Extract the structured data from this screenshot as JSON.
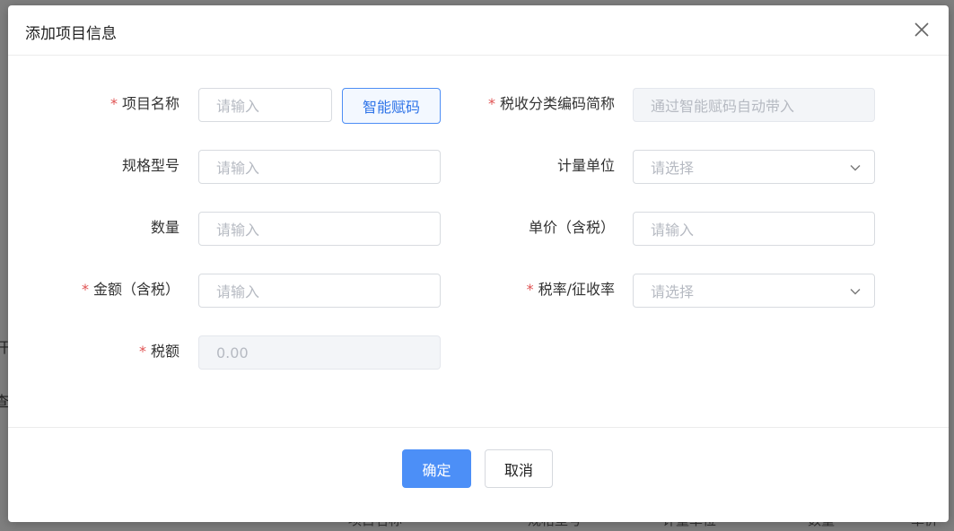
{
  "background": {
    "left_fragments": [
      "开",
      "查"
    ],
    "table_headers": [
      "项目名称",
      "规格型号",
      "计量单位",
      "数量",
      "单价"
    ]
  },
  "dialog": {
    "title": "添加项目信息",
    "close_icon": "close-icon",
    "fields": {
      "item_name": {
        "label": "项目名称",
        "required": "*",
        "placeholder": "请输入"
      },
      "smart_code_button": "智能赋码",
      "tax_code_abbr": {
        "label": "税收分类编码简称",
        "required": "*",
        "placeholder": "通过智能赋码自动带入"
      },
      "spec_model": {
        "label": "规格型号",
        "placeholder": "请输入"
      },
      "unit": {
        "label": "计量单位",
        "placeholder": "请选择"
      },
      "quantity": {
        "label": "数量",
        "placeholder": "请输入"
      },
      "unit_price": {
        "label": "单价（含税）",
        "placeholder": "请输入"
      },
      "amount": {
        "label": "金额（含税）",
        "required": "*",
        "placeholder": "请输入"
      },
      "tax_rate": {
        "label": "税率/征收率",
        "required": "*",
        "placeholder": "请选择"
      },
      "tax_amount": {
        "label": "税额",
        "required": "*",
        "value": "0.00"
      }
    },
    "buttons": {
      "confirm": "确定",
      "cancel": "取消"
    }
  },
  "colors": {
    "primary": "#4c8ff7",
    "required": "#e05252"
  }
}
